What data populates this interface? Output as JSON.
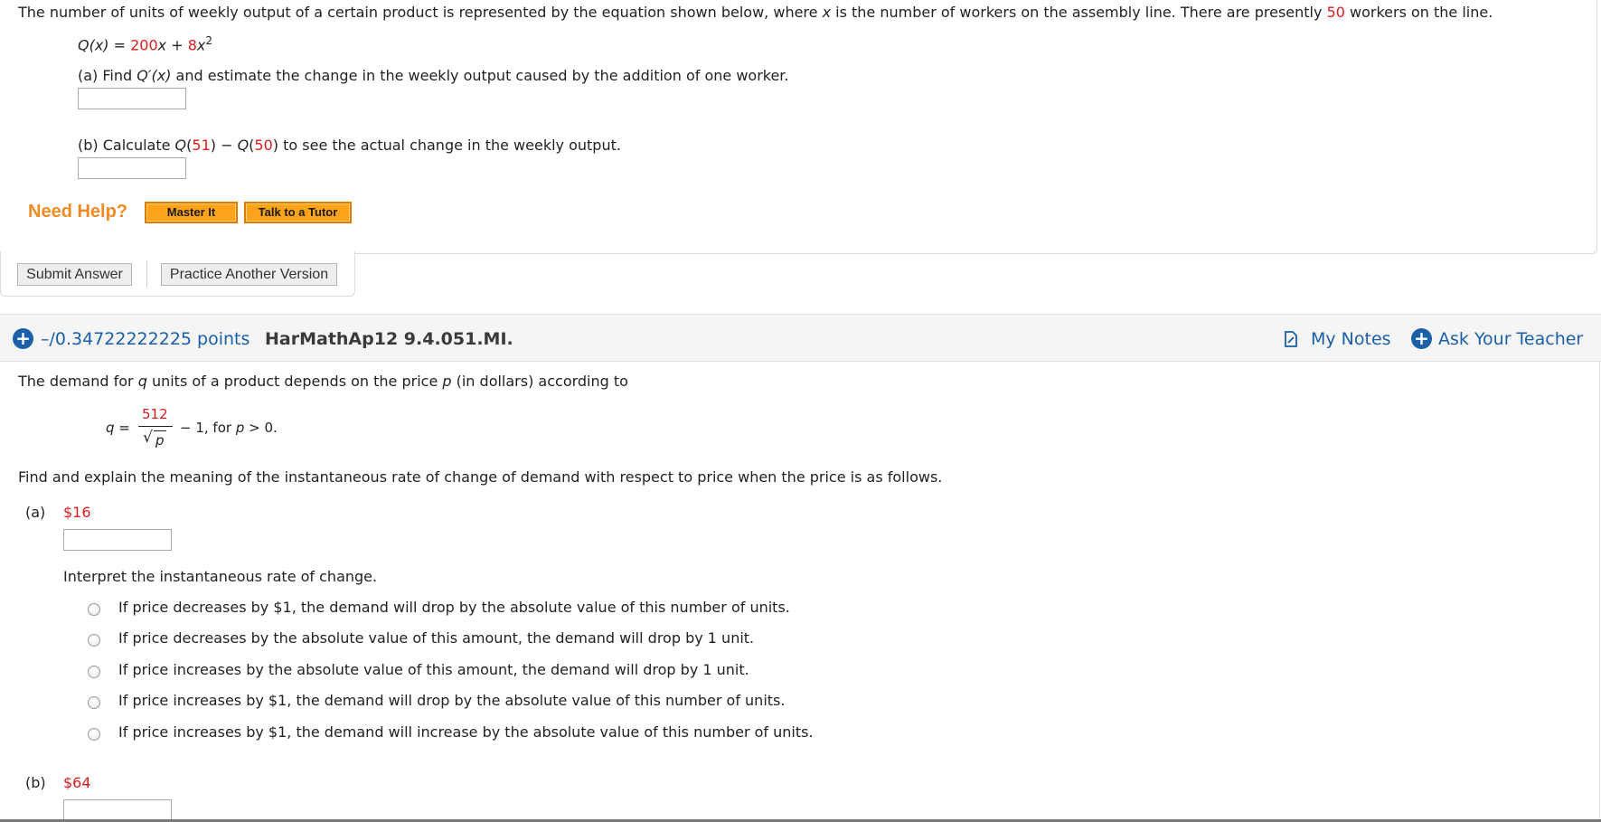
{
  "q1": {
    "intro_pre": "The number of units of weekly output of a certain product is represented by the equation shown below, where ",
    "intro_var": "x",
    "intro_mid": " is the number of workers on the assembly line. There are presently ",
    "intro_num": "50",
    "intro_post": " workers on the line.",
    "eq_lhs": "Q(x) = ",
    "eq_c1": "200",
    "eq_x1": "x",
    "eq_plus": " + ",
    "eq_c2": "8",
    "eq_x2": "x",
    "eq_exp": "2",
    "part_a_pre": "(a) Find ",
    "part_a_fn": "Q′(x)",
    "part_a_post": " and estimate the change in the weekly output caused by the addition of one worker.",
    "part_b_pre": "(b) Calculate ",
    "part_b_q1": "Q",
    "part_b_p1": "(",
    "part_b_n1": "51",
    "part_b_p2": ") − ",
    "part_b_q2": "Q",
    "part_b_p3": "(",
    "part_b_n2": "50",
    "part_b_post": ") to see the actual change in the weekly output."
  },
  "help": {
    "title": "Need Help?",
    "master_it": "Master It",
    "talk_tutor": "Talk to a Tutor"
  },
  "actions": {
    "submit": "Submit Answer",
    "practice": "Practice Another Version"
  },
  "q2_header": {
    "points": "–/0.34722222225 points",
    "code": "HarMathAp12 9.4.051.MI.",
    "my_notes": "My Notes",
    "ask_teacher": "Ask Your Teacher"
  },
  "q2": {
    "intro_pre": "The demand for ",
    "intro_q": "q",
    "intro_mid": " units of a product depends on the price ",
    "intro_p": "p",
    "intro_post": " (in dollars) according to",
    "eq_lhs": "q =",
    "eq_num": "512",
    "eq_sqrt": "√",
    "eq_p": "p",
    "eq_rest": "− 1,  for ",
    "eq_p2": "p",
    "eq_cond": " > 0.",
    "instruction": "Find and explain the meaning of the instantaneous rate of change of demand with respect to price when the price is as follows.",
    "part_a_label": "(a)",
    "part_a_value": "$16",
    "interpret_label": "Interpret the instantaneous rate of change.",
    "options": [
      "If price decreases by $1, the demand will drop by the absolute value of this number of units.",
      "If price decreases by the absolute value of this amount, the demand will drop by 1 unit.",
      "If price increases by the absolute value of this amount, the demand will drop by 1 unit.",
      "If price increases by $1, the demand will drop by the absolute value of this number of units.",
      "If price increases by $1, the demand will increase by the absolute value of this number of units."
    ],
    "part_b_label": "(b)",
    "part_b_value": "$64"
  },
  "colors": {
    "highlight_red": "#d61e1e",
    "link_blue": "#1a5fa8",
    "help_orange": "#f08a24",
    "button_orange": "#ffa31a"
  },
  "icons": {
    "expand": "plus-circle-icon",
    "notes": "notes-icon",
    "ask": "plus-circle-icon"
  }
}
